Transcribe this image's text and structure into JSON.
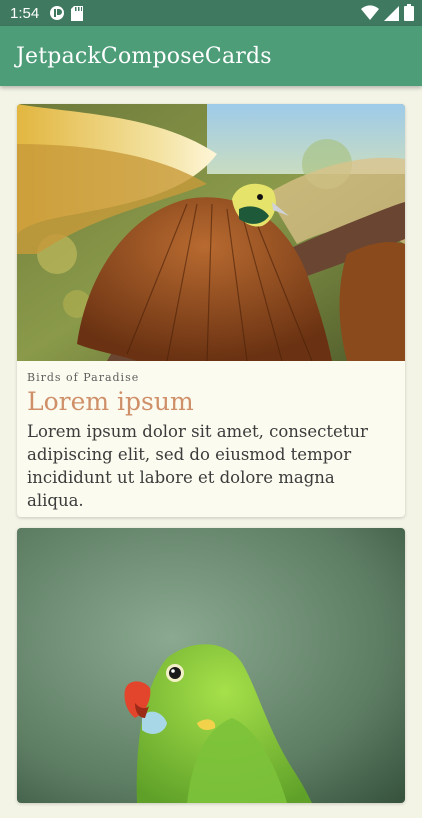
{
  "status_bar": {
    "time": "1:54",
    "left_icons": [
      "media-icon",
      "sd-card-icon"
    ],
    "right_icons": [
      "wifi-icon",
      "signal-icon",
      "battery-icon"
    ]
  },
  "app_bar": {
    "title": "JetpackComposeCards"
  },
  "colors": {
    "status_bar": "#3f7960",
    "app_bar": "#4e9d79",
    "background": "#f3f4e6",
    "card": "#fbfbef",
    "title_accent": "#cf8f68"
  },
  "cards": [
    {
      "image": "bird-of-paradise-photo",
      "overline": "Birds of Paradise",
      "title": "Lorem ipsum",
      "text": "Lorem ipsum dolor sit amet, consectetur adipiscing elit, sed do eiusmod tempor incididunt ut labore et dolore magna aliqua."
    },
    {
      "image": "green-parrot-photo"
    }
  ]
}
